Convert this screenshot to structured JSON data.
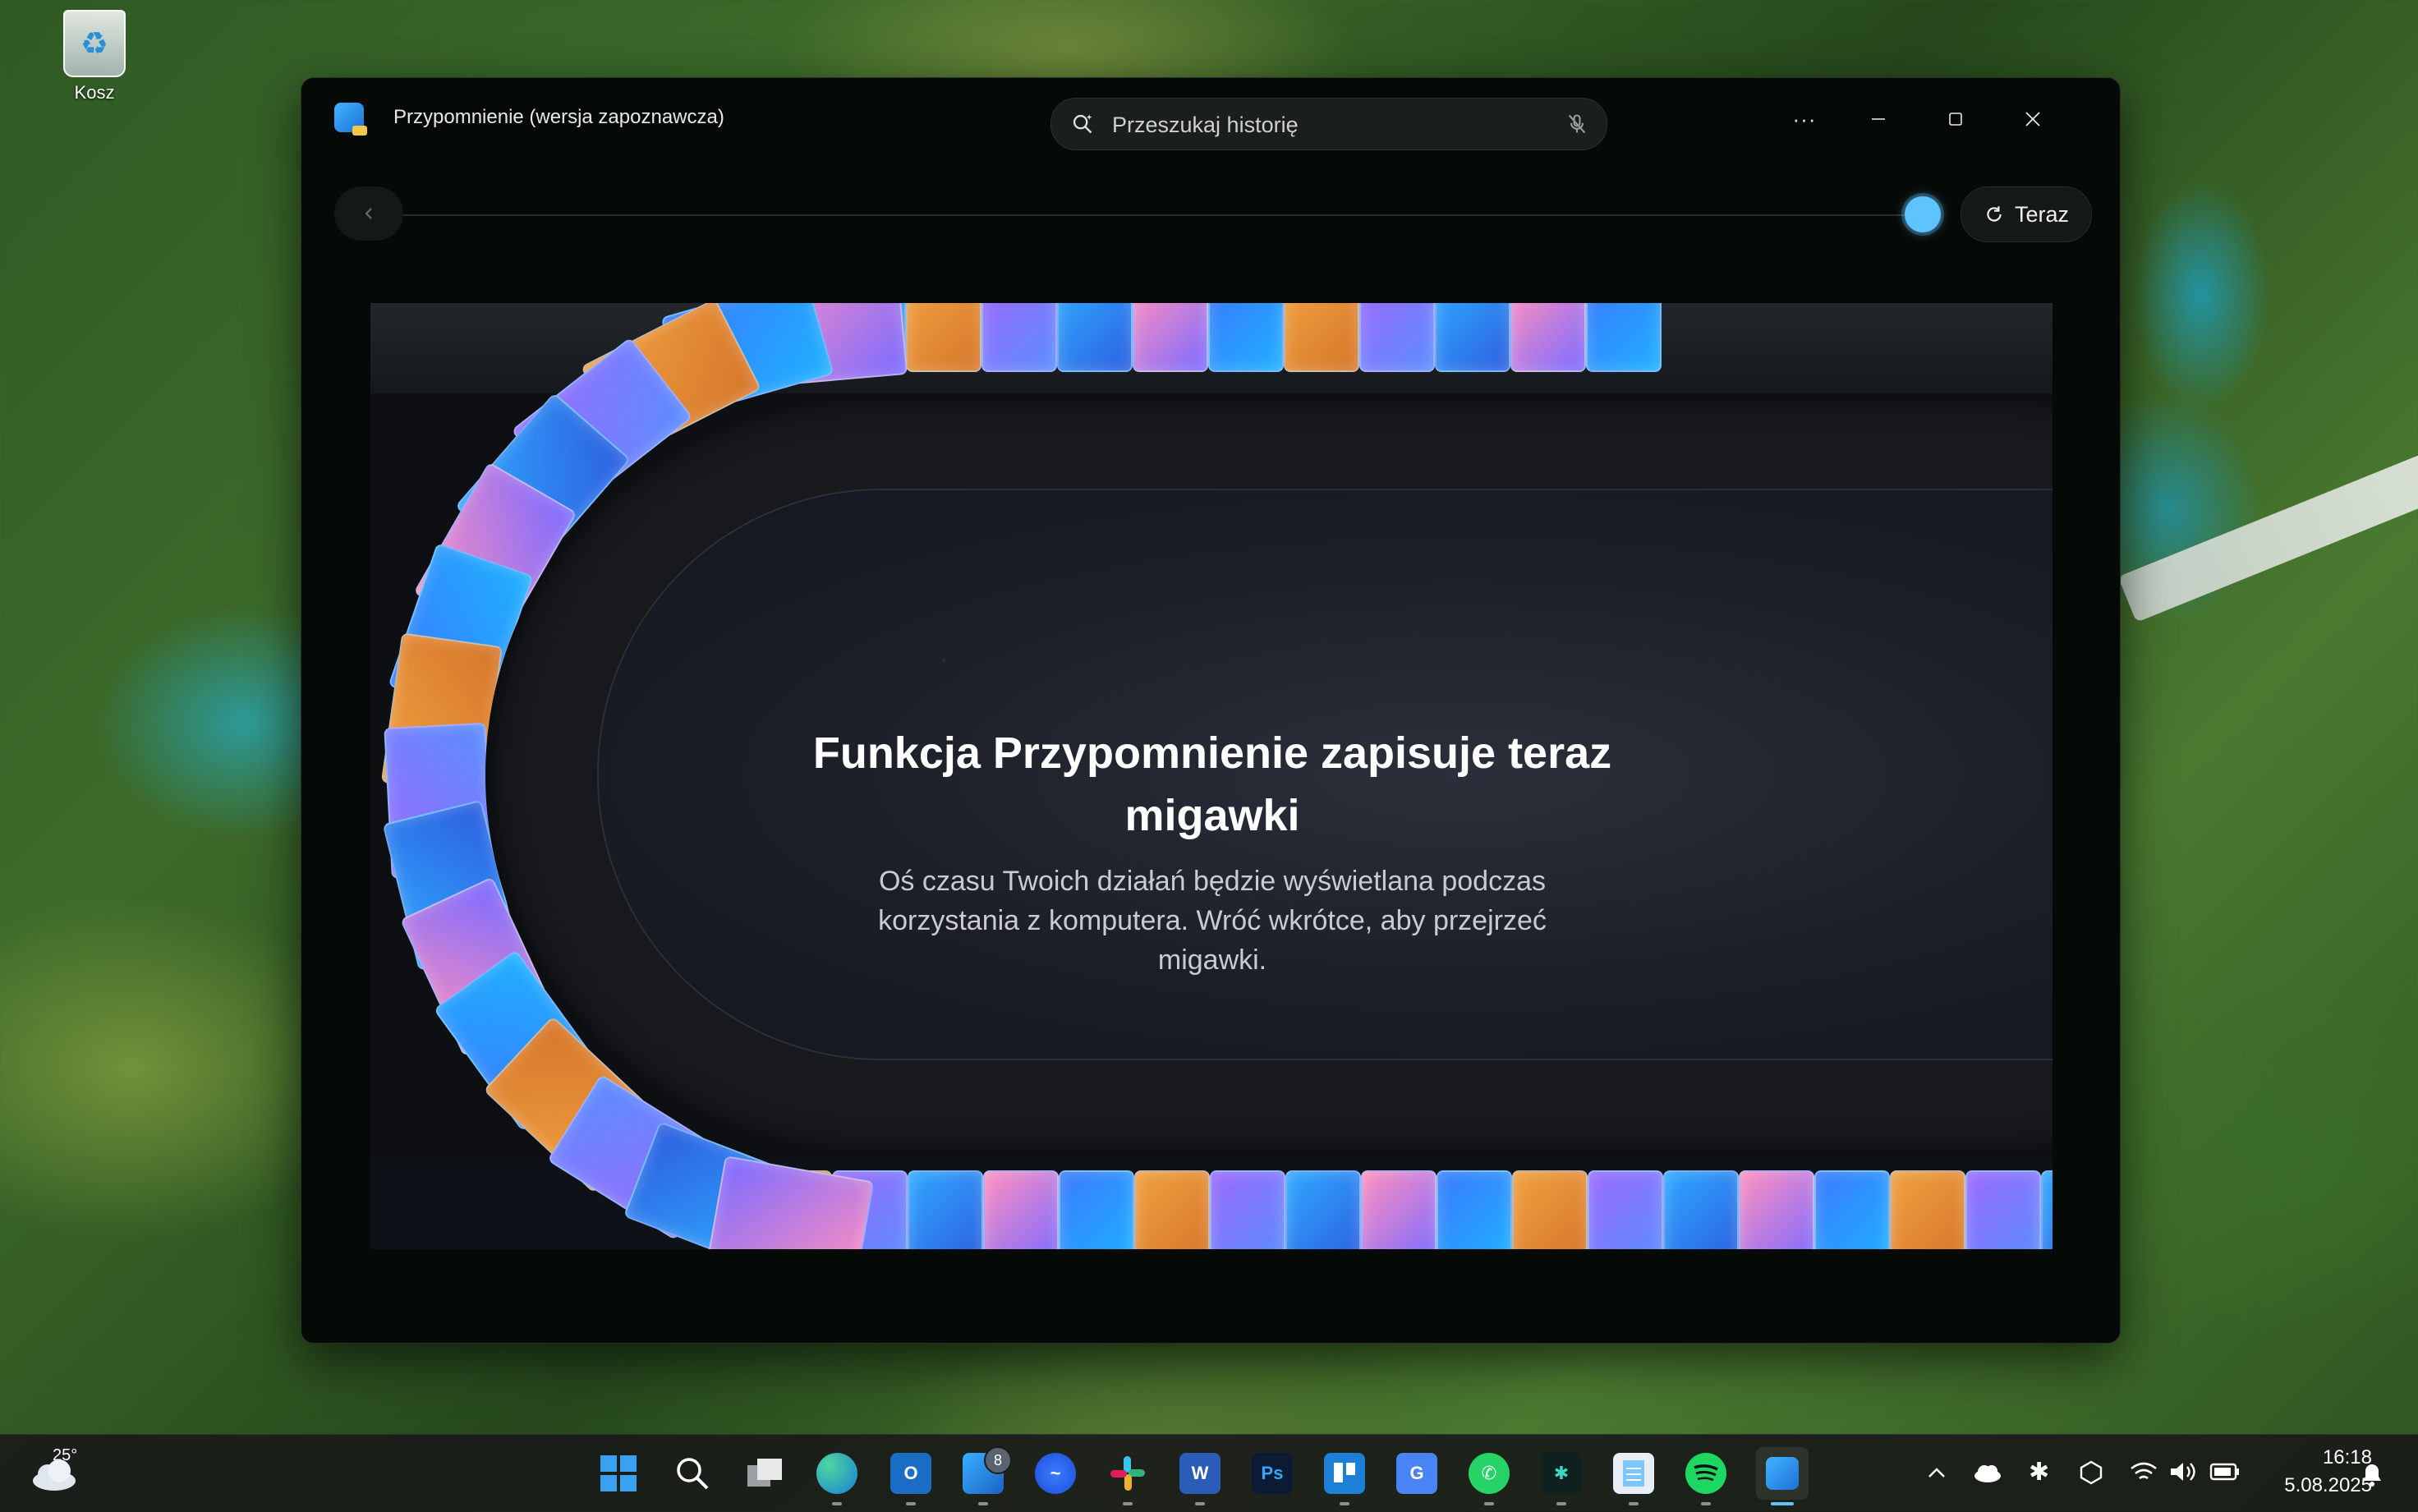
{
  "desktop": {
    "recycle_bin_label": "Kosz"
  },
  "window": {
    "title": "Przypomnienie (wersja zapoznawcza)",
    "search_placeholder": "Przeszukaj historię",
    "more_label": "···",
    "now_button_label": "Teraz"
  },
  "hero": {
    "title": "Funkcja Przypomnienie zapisuje teraz migawki",
    "description": "Oś czasu Twoich działań będzie wyświetlana podczas korzystania z komputera. Wróć wkrótce, aby przejrzeć migawki."
  },
  "taskbar": {
    "weather_temp": "25°",
    "badge_count": "8",
    "time": "16:18",
    "date": "5.08.2025",
    "apps": [
      "start",
      "search",
      "task-view",
      "edge",
      "outlook",
      "microsoft-store",
      "messenger",
      "slack",
      "word",
      "photoshop",
      "trello",
      "google-translate",
      "whatsapp",
      "perplexity",
      "notepad",
      "spotify",
      "recall"
    ]
  },
  "colors": {
    "accent": "#5fc3ff",
    "window_bg": "#060a07"
  }
}
